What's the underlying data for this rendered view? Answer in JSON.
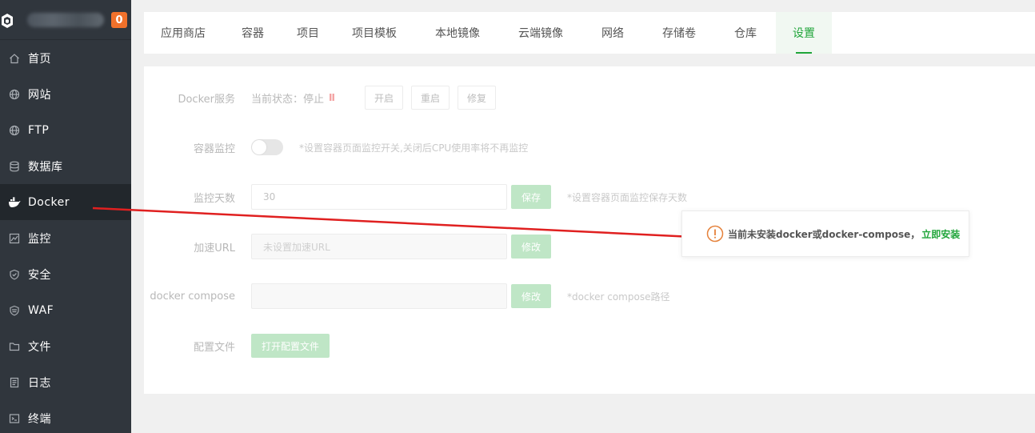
{
  "sidebar": {
    "badge": "0",
    "items": [
      {
        "label": "首页",
        "icon": "home-icon"
      },
      {
        "label": "网站",
        "icon": "globe-icon"
      },
      {
        "label": "FTP",
        "icon": "globe-icon"
      },
      {
        "label": "数据库",
        "icon": "database-icon"
      },
      {
        "label": "Docker",
        "icon": "docker-icon"
      },
      {
        "label": "监控",
        "icon": "monitor-icon"
      },
      {
        "label": "安全",
        "icon": "shield-icon"
      },
      {
        "label": "WAF",
        "icon": "waf-shield-icon"
      },
      {
        "label": "文件",
        "icon": "folder-icon"
      },
      {
        "label": "日志",
        "icon": "log-icon"
      },
      {
        "label": "终端",
        "icon": "terminal-icon"
      }
    ],
    "active_item": "Docker"
  },
  "tabs": [
    "应用商店",
    "容器",
    "项目",
    "项目模板",
    "本地镜像",
    "云端镜像",
    "网络",
    "存储卷",
    "仓库",
    "设置"
  ],
  "active_tab": "设置",
  "settings": {
    "docker_service": {
      "label": "Docker服务",
      "status_text": "当前状态：停止",
      "pause_glyph": "II",
      "start_btn": "开启",
      "restart_btn": "重启",
      "repair_btn": "修复"
    },
    "container_monitor": {
      "label": "容器监控",
      "enabled": false,
      "hint": "*设置容器页面监控开关,关闭后CPU使用率将不再监控"
    },
    "monitor_days": {
      "label": "监控天数",
      "value": "30",
      "save_btn": "保存",
      "hint": "*设置容器页面监控保存天数"
    },
    "accel_url": {
      "label": "加速URL",
      "placeholder": "未设置加速URL",
      "edit_btn": "修改"
    },
    "docker_compose": {
      "label": "docker compose",
      "value": "",
      "edit_btn": "修改",
      "hint": "*docker compose路径"
    },
    "config_file": {
      "label": "配置文件",
      "open_btn": "打开配置文件"
    }
  },
  "popup": {
    "message": "当前未安装docker或docker-compose，",
    "link": "立即安装",
    "icon": "warning-icon"
  },
  "colors": {
    "sidebar_bg": "#30363d",
    "accent_green": "#20a53a",
    "badge_orange": "#f0712b",
    "warning_orange": "#e5813a",
    "arrow_red": "#e02020"
  }
}
